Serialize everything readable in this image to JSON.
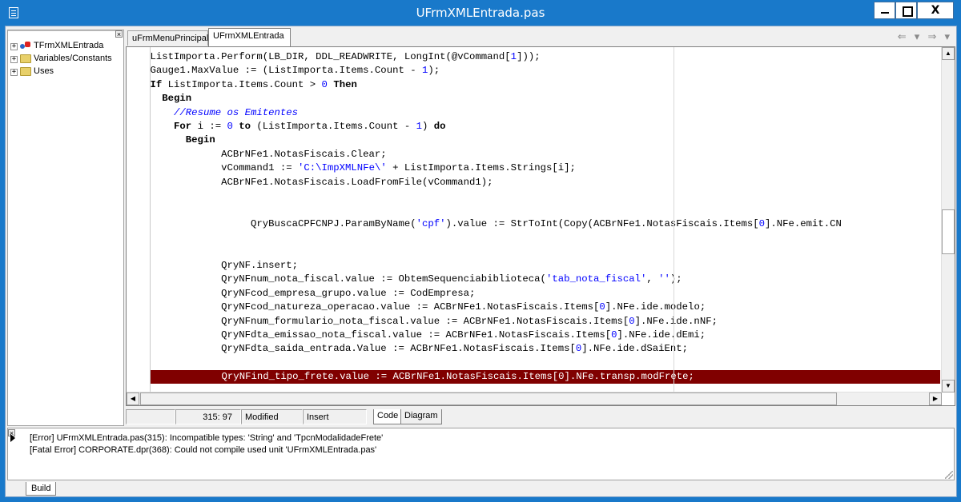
{
  "window": {
    "title": "UFrmXMLEntrada.pas",
    "controls": [
      "minimize",
      "maximize",
      "close"
    ],
    "close_label": "X"
  },
  "tree": {
    "close_glyph": "×",
    "items": [
      {
        "label": "TFrmXMLEntrada",
        "expander": "+",
        "icon": "class-icon"
      },
      {
        "label": "Variables/Constants",
        "expander": "+",
        "icon": "folder-icon"
      },
      {
        "label": "Uses",
        "expander": "+",
        "icon": "folder-icon"
      }
    ]
  },
  "tabs": [
    {
      "label": "uFrmMenuPrincipal",
      "active": false
    },
    {
      "label": "UFrmXMLEntrada",
      "active": true
    }
  ],
  "nav_arrows": "⇐ ▾ ⇒ ▾",
  "code_lines": [
    "    ListImporta.Perform(LB_DIR, DDL_READWRITE, LongInt(@vCommand[1]));",
    "    Gauge1.MaxValue := (ListImporta.Items.Count - 1);",
    "    If ListImporta.Items.Count > 0 Then",
    "      Begin",
    "        //Resume os Emitentes",
    "        For i := 0 to (ListImporta.Items.Count - 1) do",
    "          Begin",
    "                ACBrNFe1.NotasFiscais.Clear;",
    "                vCommand1 := 'C:\\ImpXMLNFe\\' + ListImporta.Items.Strings[i];",
    "                ACBrNFe1.NotasFiscais.LoadFromFile(vCommand1);",
    "",
    "",
    "                     QryBuscaCPFCNPJ.ParamByName('cpf').value := StrToInt(Copy(ACBrNFe1.NotasFiscais.Items[0].NFe.emit.CN",
    "",
    "",
    "                QryNF.insert;",
    "                QryNFnum_nota_fiscal.value := ObtemSequenciabiblioteca('tab_nota_fiscal', '');",
    "                QryNFcod_empresa_grupo.value := CodEmpresa;",
    "                QryNFcod_natureza_operacao.value := ACBrNFe1.NotasFiscais.Items[0].NFe.ide.modelo;",
    "                QryNFnum_formulario_nota_fiscal.value := ACBrNFe1.NotasFiscais.Items[0].NFe.ide.nNF;",
    "                QryNFdta_emissao_nota_fiscal.value := ACBrNFe1.NotasFiscais.Items[0].NFe.ide.dEmi;",
    "                QryNFdta_saida_entrada.Value := ACBrNFe1.NotasFiscais.Items[0].NFe.ide.dSaiEnt;",
    "",
    "                QryNFind_tipo_frete.value := ACBrNFe1.NotasFiscais.Items[0].NFe.transp.modFrete;"
  ],
  "highlighted_line_index": 23,
  "status": {
    "position": "315:  97",
    "modified": "Modified",
    "insert_mode": "Insert",
    "view_tabs": [
      "Code",
      "Diagram"
    ]
  },
  "messages": {
    "close_glyph": "×",
    "lines": [
      "[Error] UFrmXMLEntrada.pas(315): Incompatible types: 'String' and 'TpcnModalidadeFrete'",
      "[Fatal Error] CORPORATE.dpr(368): Could not compile used unit 'UFrmXMLEntrada.pas'"
    ],
    "tab": "Build"
  },
  "colors": {
    "titlebar": "#1979ca",
    "highlight_line": "#800000",
    "string_literal": "#0000ff"
  }
}
